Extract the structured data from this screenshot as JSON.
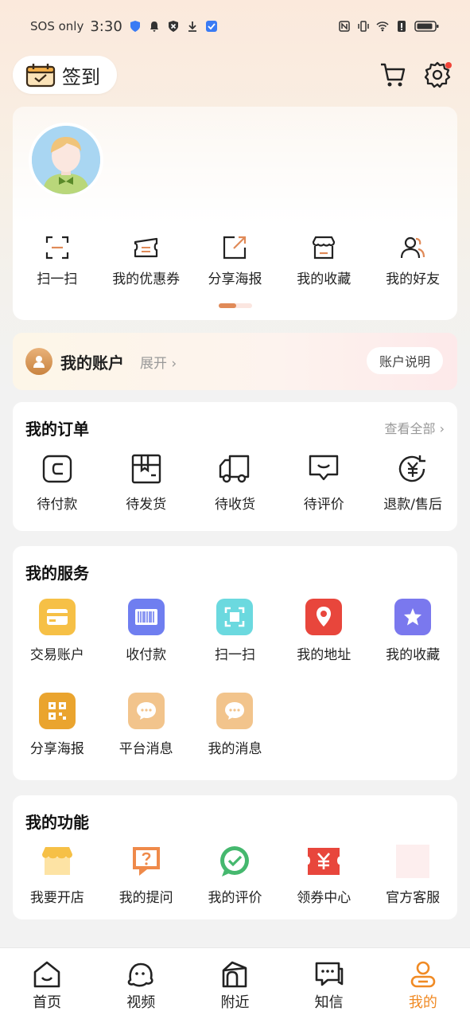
{
  "status_bar": {
    "carrier": "SOS only",
    "time": "3:30"
  },
  "header": {
    "checkin_label": "签到"
  },
  "quick_actions": [
    {
      "label": "扫一扫",
      "icon": "scan-icon"
    },
    {
      "label": "我的优惠券",
      "icon": "coupon-icon"
    },
    {
      "label": "分享海报",
      "icon": "share-icon"
    },
    {
      "label": "我的收藏",
      "icon": "store-icon"
    },
    {
      "label": "我的好友",
      "icon": "friends-icon"
    }
  ],
  "account": {
    "title": "我的账户",
    "expand": "展开 ›",
    "explain": "账户说明"
  },
  "orders": {
    "title": "我的订单",
    "view_all": "查看全部 ›",
    "items": [
      {
        "label": "待付款",
        "icon": "wallet-icon"
      },
      {
        "label": "待发货",
        "icon": "package-icon"
      },
      {
        "label": "待收货",
        "icon": "truck-icon"
      },
      {
        "label": "待评价",
        "icon": "comment-icon"
      },
      {
        "label": "退款/售后",
        "icon": "refund-icon"
      }
    ]
  },
  "services": {
    "title": "我的服务",
    "items": [
      {
        "label": "交易账户",
        "icon": "card-icon",
        "color": "#f6c046"
      },
      {
        "label": "收付款",
        "icon": "barcode-icon",
        "color": "#6f7ef0"
      },
      {
        "label": "扫一扫",
        "icon": "scan-icon",
        "color": "#6bd9df"
      },
      {
        "label": "我的地址",
        "icon": "location-icon",
        "color": "#e8463c"
      },
      {
        "label": "我的收藏",
        "icon": "star-icon",
        "color": "#7a78ee"
      },
      {
        "label": "分享海报",
        "icon": "qrcode-icon",
        "color": "#eaa42e"
      },
      {
        "label": "平台消息",
        "icon": "chat-bubble-icon",
        "color": "#f2c48c"
      },
      {
        "label": "我的消息",
        "icon": "chat-bubble-icon",
        "color": "#f2c48c"
      }
    ]
  },
  "functions": {
    "title": "我的功能",
    "items": [
      {
        "label": "我要开店",
        "icon": "shop-icon"
      },
      {
        "label": "我的提问",
        "icon": "question-icon"
      },
      {
        "label": "我的评价",
        "icon": "review-check-icon"
      },
      {
        "label": "领券中心",
        "icon": "ticket-icon"
      },
      {
        "label": "官方客服",
        "icon": "service-icon"
      }
    ]
  },
  "bottom_nav": [
    {
      "label": "首页",
      "icon": "home-icon",
      "active": false
    },
    {
      "label": "视频",
      "icon": "video-icon",
      "active": false
    },
    {
      "label": "附近",
      "icon": "nearby-icon",
      "active": false
    },
    {
      "label": "知信",
      "icon": "message-icon",
      "active": false
    },
    {
      "label": "我的",
      "icon": "profile-icon",
      "active": true
    }
  ],
  "colors": {
    "accent": "#f08a24",
    "background": "#f2f2f2"
  }
}
